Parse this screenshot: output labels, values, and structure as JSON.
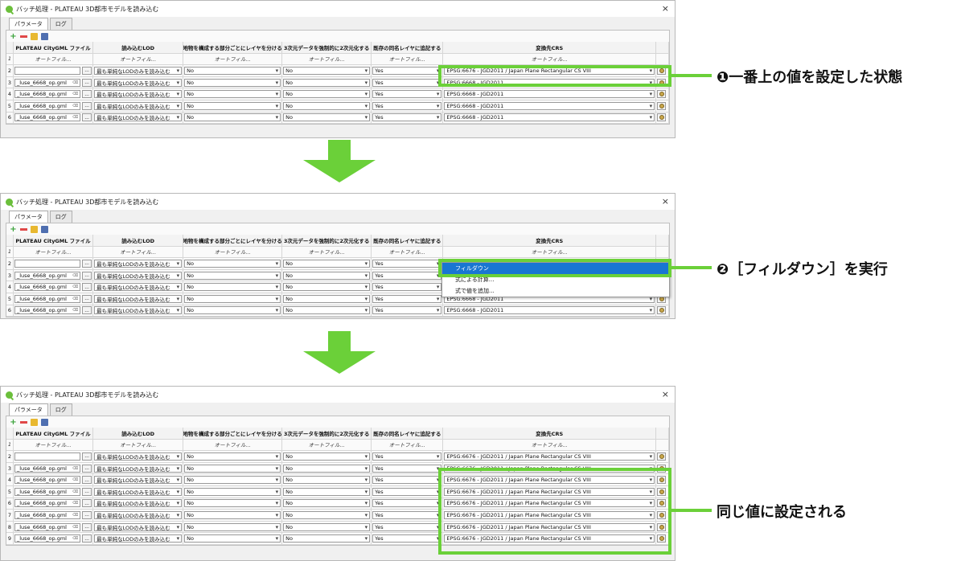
{
  "dialog": {
    "title": "バッチ処理 - PLATEAU 3D都市モデルを読み込む",
    "close_label": "×",
    "tabs": [
      "パラメータ",
      "ログ"
    ]
  },
  "columns": [
    "",
    "PLATEAU CityGML ファイル",
    "読み込むLOD",
    "地物を構成する部分ごとにレイヤを分ける",
    "3次元データを強制的に2次元化する",
    "既存の同名レイヤに追記する",
    "変換先CRS"
  ],
  "autofill_label": "オートフィル...",
  "values": {
    "file": "_luse_6668_op.gml",
    "lod": "最も単純なLODのみを読み込む",
    "split": "No",
    "force2d": "No",
    "append": "Yes",
    "crs_default": "EPSG:6668 - JGD2011",
    "crs_set": "EPSG:6676 - JGD2011 / Japan Plane Rectangular CS VIII"
  },
  "panel1": {
    "row_numbers": [
      "1",
      "2",
      "3",
      "4",
      "5",
      "6"
    ]
  },
  "panel2": {
    "row_numbers": [
      "1",
      "2",
      "3",
      "4",
      "5",
      "6"
    ],
    "context_menu": [
      "フィルダウン",
      "式による計算...",
      "式で値を追加..."
    ]
  },
  "panel3": {
    "row_numbers": [
      "1",
      "2",
      "3",
      "4",
      "5",
      "6",
      "7",
      "8",
      "9"
    ]
  },
  "callouts": {
    "c1": "❶一番上の値を設定した状態",
    "c2": "❷［フィルダウン］を実行",
    "c3": "同じ値に設定される"
  },
  "colors": {
    "accent_green": "#6bd039",
    "menu_selection": "#1976d2"
  }
}
